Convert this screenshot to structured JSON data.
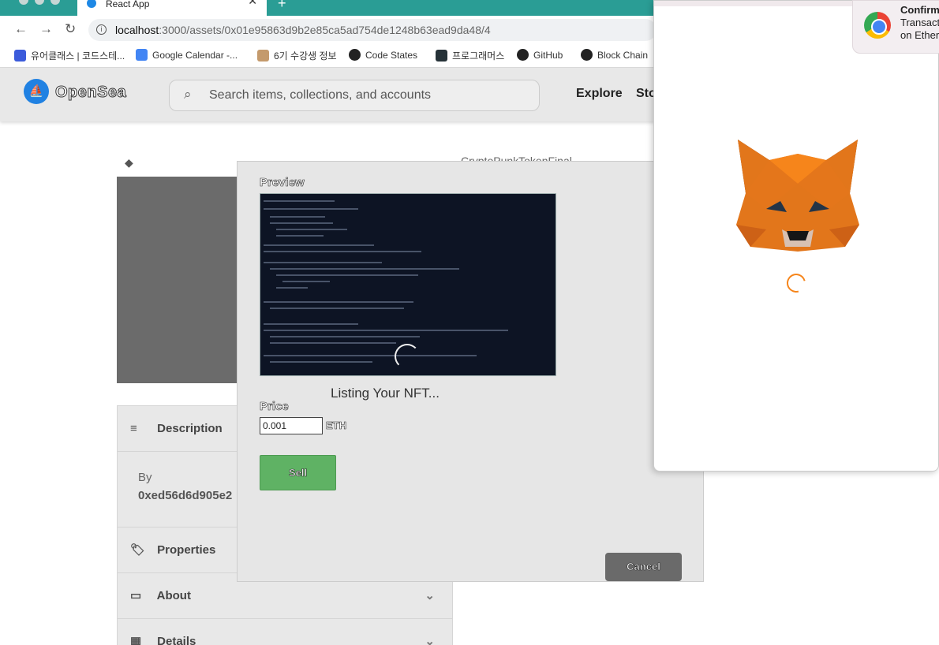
{
  "browser": {
    "tab_title": "React App",
    "new_tab_symbol": "+",
    "close_symbol": "✕",
    "url_host": "localhost",
    "url_rest": ":3000/assets/0x01e95863d9b2e85ca5ad754de1248b63ead9da48/4",
    "bookmarks": [
      {
        "label": "유어클래스 | 코드스테...",
        "color": "#3b5bdb"
      },
      {
        "label": "Google Calendar -...",
        "color": "#4285f4"
      },
      {
        "label": "6기 수강생 정보",
        "color": "#c49a6c"
      },
      {
        "label": "Code States",
        "color": "#222222"
      },
      {
        "label": "프로그래머스",
        "color": "#263238"
      },
      {
        "label": "GitHub",
        "color": "#222222"
      },
      {
        "label": "Block Chain",
        "color": "#222222"
      }
    ]
  },
  "site": {
    "logo_text": "OpenSea",
    "search_placeholder": "Search items, collections, and accounts",
    "nav": [
      "Explore",
      "Sto"
    ],
    "title_peek": "CryptoPunkTokenFinal",
    "panel": {
      "description": "Description",
      "by_label": "By",
      "by_address": "0xed56d6d905e2",
      "properties": "Properties",
      "about": "About",
      "details": "Details"
    }
  },
  "modal": {
    "preview_label": "Preview",
    "status_text": "Listing Your NFT...",
    "price_label": "Price",
    "price_value": "0.001",
    "price_unit": "ETH",
    "sell_label": "Sell",
    "cancel_label": "Cancel"
  },
  "notification": {
    "line1": "Confirm",
    "line2": "Transact",
    "line3": "on Ether"
  },
  "colors": {
    "tabbar": "#2a9d95",
    "opensea_blue": "#2081e2",
    "sell_green": "#5fb264",
    "metamask_orange": "#f6851b"
  }
}
